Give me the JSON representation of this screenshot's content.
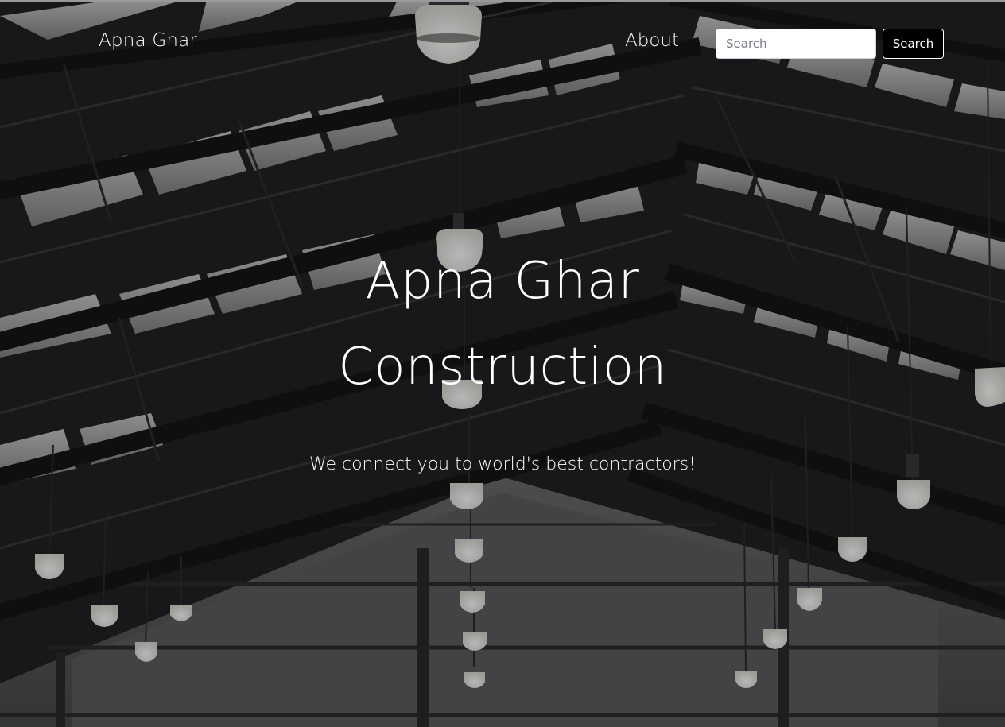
{
  "navbar": {
    "brand": "Apna Ghar",
    "links": [
      {
        "label": "About"
      }
    ],
    "search": {
      "placeholder": "Search",
      "value": "",
      "button_label": "Search"
    }
  },
  "hero": {
    "title_line1": "Apna Ghar",
    "title_line2": "Construction",
    "subtitle": "We connect you to world's best contractors!",
    "background": "warehouse-ceiling-with-pendant-lamps-photo"
  },
  "colors": {
    "text": "#ffffff",
    "button_bg": "#000000",
    "overlay": "#000000"
  }
}
